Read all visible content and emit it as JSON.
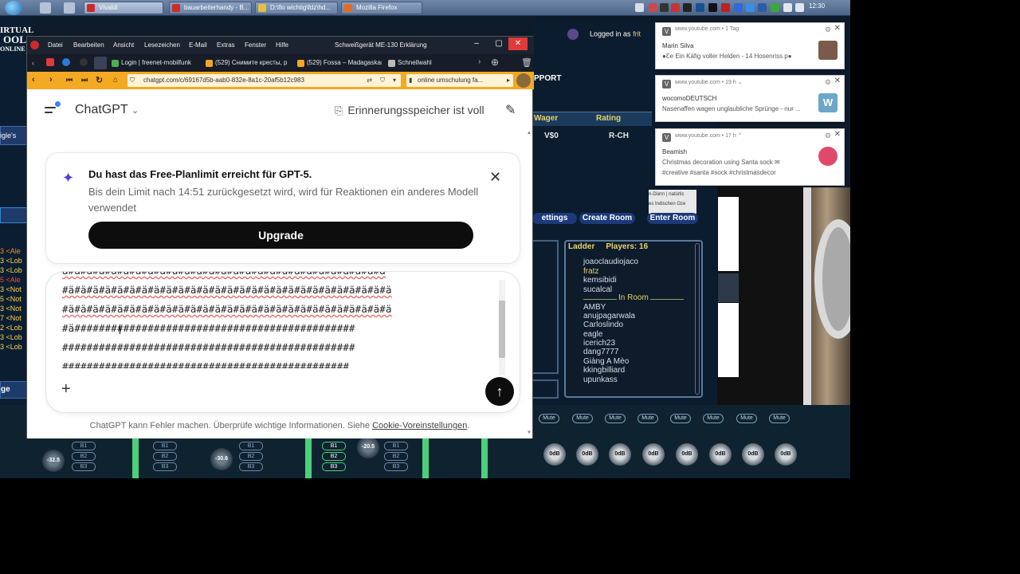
{
  "taskbar": {
    "tasks": [
      {
        "label": "Vivaldi",
        "color": "#cc2b2b"
      },
      {
        "label": "bauarbeiterhandy - B...",
        "color": "#cc2b2b"
      },
      {
        "label": "D:\\flo wichtig\\fdz\\hd...",
        "color": "#e8c040"
      },
      {
        "label": "Mozilla Firefox",
        "color": "#e86a1f"
      }
    ],
    "clock": "12:30"
  },
  "virtual_pool": {
    "logo_line1": "IRTUAL",
    "logo_line2": "OOL",
    "logo_line3": "ONLINE",
    "left_texts": [
      "igle's",
      "3 <Ale",
      "3 <Lob",
      "3 <Lob",
      "5 <Ale",
      "3 <Not",
      "5 <Not",
      "3 <Not",
      "7 <Not",
      "2 <Lob",
      "3 <Lob",
      "3 <Lob"
    ],
    "side_button": "ge",
    "logged_in": "Logged in as",
    "logged_user": "frit",
    "support": "PPORT",
    "wager_header": "Wager",
    "rating_header": "Rating",
    "wager_value": "V$0",
    "rating_value": "R-CH",
    "settings_tab": "ettings",
    "create_room": "Create Room",
    "enter_room": "Enter Room",
    "ladder_label": "Ladder",
    "players_label": "Players: 16",
    "ladder_names": [
      "joaoclaudiojaco",
      "fratz",
      "kemsibidi",
      "sucalcal"
    ],
    "in_room_label": "In Room",
    "room_names": [
      "AMBY",
      "anujpagarwala",
      "Carloslindo",
      "eagle",
      "icerich23",
      "dang7777",
      "Giàng A Mèo",
      "kkingbilliard",
      "upunkass"
    ],
    "side_snippets": [
      "n-Dürrn | natürlic",
      "es Indischen Oze"
    ]
  },
  "mixer": {
    "knobs": [
      "-32.5",
      "-30.6",
      "-20.5",
      "0dB",
      "0dB",
      "0dB",
      "0dB",
      "0dB",
      "0dB",
      "0dB",
      "0dB"
    ],
    "mute_label": "Mute",
    "bus_labels": [
      "B1",
      "B2",
      "B3"
    ]
  },
  "notifications": [
    {
      "source": "www.youtube.com • 1 Tag",
      "title": "Marin Silva",
      "body": "●Ɛe Ein Käfig voller Helden - 14 Hosenriss p●",
      "thumb": "#7a5a4a"
    },
    {
      "source": "www.youtube.com • 19 h ⌄",
      "title": "wocomoDEUTSCH",
      "body": "Nasenaffen wagen unglaubliche Sprünge - nur ...",
      "thumb": "#6aa7c9"
    },
    {
      "source": "www.youtube.com • 17 h ⌃",
      "title": "Beamish",
      "body": "Christmas decoration using Santa sock ✉",
      "body2": "#creative #santa #sock #christmasdecor",
      "thumb": "#e04a6a"
    }
  ],
  "browser": {
    "menu": [
      "Datei",
      "Bearbeiten",
      "Ansicht",
      "Lesezeichen",
      "E-Mail",
      "Extras",
      "Fenster",
      "Hilfe"
    ],
    "window_title": "Schweißgerät ME-130 Erklärung",
    "tabs": [
      {
        "label": "Login | freenet-mobilfunk",
        "color": "#4caf50"
      },
      {
        "label": "(529) Снимите кресты, р",
        "color": "#f5a623"
      },
      {
        "label": "(529) Fossa – Madagaskar",
        "color": "#f5a623"
      },
      {
        "label": "Schnellwahl",
        "color": "#bbbbbb"
      }
    ],
    "url": "chatgpt.com/c/69167d5b-aab0-832e-8a1c-20af5b12c983",
    "search": "online umschulung fa...",
    "accent": "#f3a922"
  },
  "chatgpt": {
    "model": "ChatGPT",
    "memory": "Erinnerungsspeicher ist voll",
    "limit_title": "Du hast das Free-Planlimit erreicht für GPT-5.",
    "limit_body": "Bis dein Limit nach 14:51 zurückgesetzt wird, wird für Reaktionen ein anderes Modell verwendet",
    "upgrade": "Upgrade",
    "composer_lines": [
      "ä#ä#ä#ä#ä#ä#ä#ä#ä#ä#ä#ä#ä#ä#ä#ä#ä#ä#ä#ä#ä#ä#ä#ä#ä#ä#ä",
      "#ä#ä#ä#ä#ä#ä#ä#ä#ä#ä#ä#ä#ä#ä#ä#ä#ä#ä#ä#ä#ä#ä#ä#ä#ä#ä#ä",
      "#ä#ä#ä#ä#ä#ä#ä#ä#ä#ä#ä#ä#ä#ä#ä#ä#ä#ä#ä#ä#ä#ä#ä#ä#ä#ä#ä",
      "#ä##############################################",
      "################################################",
      "###############################################"
    ],
    "footer_text": "ChatGPT kann Fehler machen. Überprüfe wichtige Informationen. Siehe ",
    "footer_link": "Cookie-Voreinstellungen",
    "footer_end": "."
  }
}
